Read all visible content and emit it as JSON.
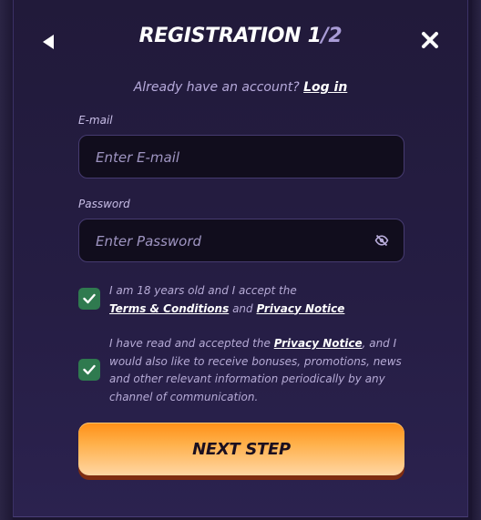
{
  "header": {
    "title": "REGISTRATION 1",
    "slash": "/",
    "step_total": "2",
    "back_icon": "back-arrow-icon",
    "close_icon": "close-icon"
  },
  "login_prompt": {
    "text": "Already have an account?",
    "link": "Log in"
  },
  "email": {
    "label": "E-mail",
    "placeholder": "Enter E-mail",
    "value": ""
  },
  "password": {
    "label": "Password",
    "placeholder": "Enter Password",
    "value": "",
    "toggle_icon": "eye-off-icon"
  },
  "consents": [
    {
      "checked": true,
      "line1": "I am 18 years old and I accept the",
      "link1": "Terms & Conditions",
      "joiner": "and",
      "link2": "Privacy Notice"
    },
    {
      "checked": true,
      "prefix": "I have read and accepted the",
      "link": "Privacy Notice",
      "line1_suffix": ", and I",
      "line2": "would also like to receive bonuses, promotions, news",
      "line3": "and other relevant information periodically by any",
      "line4": "channel of communication."
    }
  ],
  "next_button": {
    "label": "NEXT STEP"
  },
  "colors": {
    "background": "#211a3a",
    "accent_orange": "#ff8f16",
    "checkbox_green": "#2f7a4f",
    "input_bg": "#110d1d"
  }
}
